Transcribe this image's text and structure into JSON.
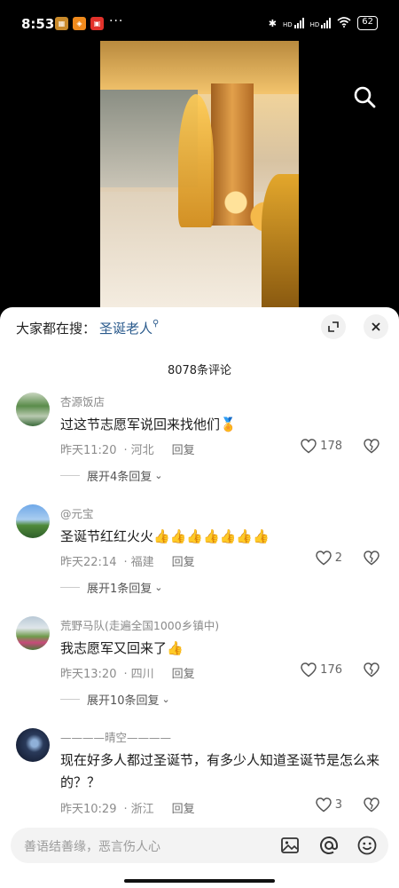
{
  "status": {
    "time": "8:53",
    "dots": "···",
    "battery": "62",
    "network_labels": [
      "HD",
      "HD"
    ]
  },
  "search": {
    "hot_label": "大家都在搜：",
    "hot_keyword": "圣诞老人"
  },
  "comments_count": "8078条评论",
  "comments": [
    {
      "user": "杏源饭店",
      "text": "过这节志愿军说回来找他们",
      "emoji": "🏅",
      "date": "昨天11:20",
      "location": "河北",
      "reply_label": "回复",
      "likes": "178",
      "expand": "展开4条回复"
    },
    {
      "user": "@元宝",
      "text": "圣诞节红红火火",
      "emoji": "👍👍👍👍👍👍👍",
      "date": "昨天22:14",
      "location": "福建",
      "reply_label": "回复",
      "likes": "2",
      "expand": "展开1条回复"
    },
    {
      "user": "荒野马队(走遍全国1000乡镇中)",
      "text": "我志愿军又回来了",
      "emoji": "👍",
      "date": "昨天13:20",
      "location": "四川",
      "reply_label": "回复",
      "likes": "176",
      "expand": "展开10条回复"
    },
    {
      "user": "————晴空————",
      "text": "现在好多人都过圣诞节，有多少人知道圣诞节是怎么来的？？",
      "emoji": "",
      "date": "昨天10:29",
      "location": "浙江",
      "reply_label": "回复",
      "likes": "3",
      "expand": ""
    }
  ],
  "input": {
    "placeholder": "善语结善缘，恶言伤人心"
  },
  "colors": {
    "accent_link": "#2a5a8c",
    "sheet_bg": "#ffffff",
    "input_bg": "#f3f3f3"
  },
  "icons": [
    "search-icon",
    "expand-icon",
    "close-icon",
    "heart-icon",
    "dislike-icon",
    "image-icon",
    "at-icon",
    "emoji-icon"
  ]
}
